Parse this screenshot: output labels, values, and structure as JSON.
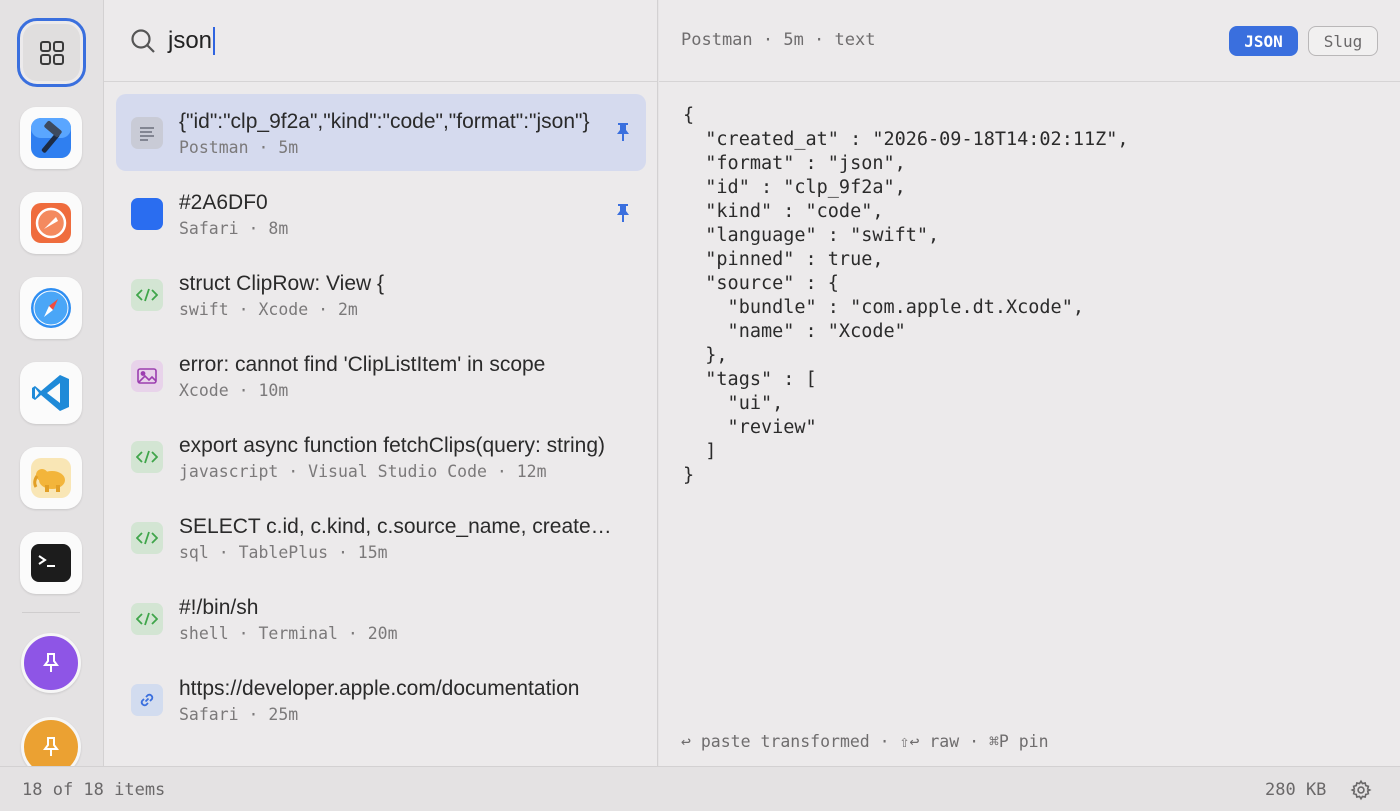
{
  "sidebar": {
    "apps": [
      {
        "name": "All",
        "icon": "grid-icon"
      },
      {
        "name": "Xcode",
        "icon": "hammer-icon"
      },
      {
        "name": "Postman",
        "icon": "postman-icon"
      },
      {
        "name": "Safari",
        "icon": "compass-icon"
      },
      {
        "name": "Visual Studio Code",
        "icon": "vscode-icon"
      },
      {
        "name": "TablePlus",
        "icon": "elephant-icon"
      },
      {
        "name": "Terminal",
        "icon": "terminal-icon"
      }
    ],
    "pins": [
      {
        "icon": "pin-icon",
        "color": "#8e55e6"
      },
      {
        "icon": "pin-icon",
        "color": "#eba132"
      }
    ]
  },
  "search": {
    "value": "json",
    "icon": "search-icon"
  },
  "items": [
    {
      "title": "{\"id\":\"clp_9f2a\",\"kind\":\"code\",\"format\":\"json\"}",
      "meta": "Postman · 5m",
      "icon": "text-lines-icon",
      "pinned": true,
      "selected": true
    },
    {
      "title": "#2A6DF0",
      "meta": "Safari · 8m",
      "icon": "color-swatch-icon",
      "color": "#2A6DF0",
      "pinned": true
    },
    {
      "title": "struct ClipRow: View {",
      "meta": "swift · Xcode · 2m",
      "icon": "code-icon"
    },
    {
      "title": "error: cannot find 'ClipListItem' in scope",
      "meta": "Xcode · 10m",
      "icon": "image-icon"
    },
    {
      "title": "export async function fetchClips(query: string)",
      "meta": "javascript · Visual Studio Code · 12m",
      "icon": "code-icon"
    },
    {
      "title": "SELECT c.id, c.kind, c.source_name, created_at",
      "meta": "sql · TablePlus · 15m",
      "icon": "code-icon"
    },
    {
      "title": "#!/bin/sh",
      "meta": "shell · Terminal · 20m",
      "icon": "code-icon"
    },
    {
      "title": "https://developer.apple.com/documentation",
      "meta": "Safari · 25m",
      "icon": "link-icon"
    }
  ],
  "detail": {
    "meta": "Postman · 5m · text",
    "formats": {
      "json": "JSON",
      "slug": "Slug"
    },
    "json_text": "{\n  \"created_at\" : \"2026-09-18T14:02:11Z\",\n  \"format\" : \"json\",\n  \"id\" : \"clp_9f2a\",\n  \"kind\" : \"code\",\n  \"language\" : \"swift\",\n  \"pinned\" : true,\n  \"source\" : {\n    \"bundle\" : \"com.apple.dt.Xcode\",\n    \"name\" : \"Xcode\"\n  },\n  \"tags\" : [\n    \"ui\",\n    \"review\"\n  ]\n}",
    "hint": "↩ paste transformed · ⇧↩ raw · ⌘P pin"
  },
  "footer": {
    "count": "18 of 18 items",
    "size": "280 KB",
    "settings_icon": "gear-icon"
  },
  "colors": {
    "accent": "#3a6fde",
    "selected_row": "#d5daee",
    "pin": "#3a6fde"
  }
}
